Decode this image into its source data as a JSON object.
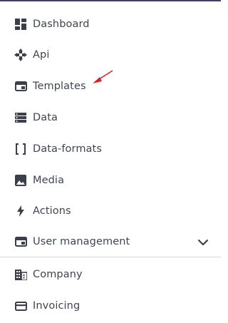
{
  "sidebar": {
    "items": [
      {
        "label": "Dashboard",
        "icon": "dashboard-icon"
      },
      {
        "label": "Api",
        "icon": "api-icon"
      },
      {
        "label": "Templates",
        "icon": "templates-icon"
      },
      {
        "label": "Data",
        "icon": "data-icon"
      },
      {
        "label": "Data-formats",
        "icon": "data-formats-icon"
      },
      {
        "label": "Media",
        "icon": "media-icon"
      },
      {
        "label": "Actions",
        "icon": "actions-icon"
      },
      {
        "label": "User management",
        "icon": "user-management-icon",
        "expandable": true
      }
    ],
    "secondary_items": [
      {
        "label": "Company",
        "icon": "company-icon"
      },
      {
        "label": "Invoicing",
        "icon": "invoicing-icon"
      }
    ]
  },
  "colors": {
    "text": "#3f4550",
    "icon": "#3a3f4a",
    "top_border": "#3d3f66",
    "divider": "#d6d6d6",
    "annotation_arrow": "#e02020"
  }
}
